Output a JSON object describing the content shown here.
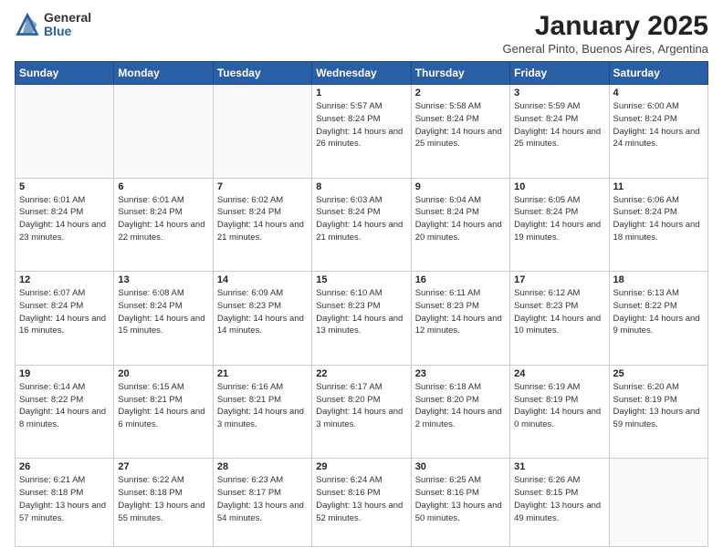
{
  "header": {
    "logo_general": "General",
    "logo_blue": "Blue",
    "month_title": "January 2025",
    "location": "General Pinto, Buenos Aires, Argentina"
  },
  "weekdays": [
    "Sunday",
    "Monday",
    "Tuesday",
    "Wednesday",
    "Thursday",
    "Friday",
    "Saturday"
  ],
  "weeks": [
    [
      {
        "day": "",
        "info": ""
      },
      {
        "day": "",
        "info": ""
      },
      {
        "day": "",
        "info": ""
      },
      {
        "day": "1",
        "info": "Sunrise: 5:57 AM\nSunset: 8:24 PM\nDaylight: 14 hours and 26 minutes."
      },
      {
        "day": "2",
        "info": "Sunrise: 5:58 AM\nSunset: 8:24 PM\nDaylight: 14 hours and 25 minutes."
      },
      {
        "day": "3",
        "info": "Sunrise: 5:59 AM\nSunset: 8:24 PM\nDaylight: 14 hours and 25 minutes."
      },
      {
        "day": "4",
        "info": "Sunrise: 6:00 AM\nSunset: 8:24 PM\nDaylight: 14 hours and 24 minutes."
      }
    ],
    [
      {
        "day": "5",
        "info": "Sunrise: 6:01 AM\nSunset: 8:24 PM\nDaylight: 14 hours and 23 minutes."
      },
      {
        "day": "6",
        "info": "Sunrise: 6:01 AM\nSunset: 8:24 PM\nDaylight: 14 hours and 22 minutes."
      },
      {
        "day": "7",
        "info": "Sunrise: 6:02 AM\nSunset: 8:24 PM\nDaylight: 14 hours and 21 minutes."
      },
      {
        "day": "8",
        "info": "Sunrise: 6:03 AM\nSunset: 8:24 PM\nDaylight: 14 hours and 21 minutes."
      },
      {
        "day": "9",
        "info": "Sunrise: 6:04 AM\nSunset: 8:24 PM\nDaylight: 14 hours and 20 minutes."
      },
      {
        "day": "10",
        "info": "Sunrise: 6:05 AM\nSunset: 8:24 PM\nDaylight: 14 hours and 19 minutes."
      },
      {
        "day": "11",
        "info": "Sunrise: 6:06 AM\nSunset: 8:24 PM\nDaylight: 14 hours and 18 minutes."
      }
    ],
    [
      {
        "day": "12",
        "info": "Sunrise: 6:07 AM\nSunset: 8:24 PM\nDaylight: 14 hours and 16 minutes."
      },
      {
        "day": "13",
        "info": "Sunrise: 6:08 AM\nSunset: 8:24 PM\nDaylight: 14 hours and 15 minutes."
      },
      {
        "day": "14",
        "info": "Sunrise: 6:09 AM\nSunset: 8:23 PM\nDaylight: 14 hours and 14 minutes."
      },
      {
        "day": "15",
        "info": "Sunrise: 6:10 AM\nSunset: 8:23 PM\nDaylight: 14 hours and 13 minutes."
      },
      {
        "day": "16",
        "info": "Sunrise: 6:11 AM\nSunset: 8:23 PM\nDaylight: 14 hours and 12 minutes."
      },
      {
        "day": "17",
        "info": "Sunrise: 6:12 AM\nSunset: 8:23 PM\nDaylight: 14 hours and 10 minutes."
      },
      {
        "day": "18",
        "info": "Sunrise: 6:13 AM\nSunset: 8:22 PM\nDaylight: 14 hours and 9 minutes."
      }
    ],
    [
      {
        "day": "19",
        "info": "Sunrise: 6:14 AM\nSunset: 8:22 PM\nDaylight: 14 hours and 8 minutes."
      },
      {
        "day": "20",
        "info": "Sunrise: 6:15 AM\nSunset: 8:21 PM\nDaylight: 14 hours and 6 minutes."
      },
      {
        "day": "21",
        "info": "Sunrise: 6:16 AM\nSunset: 8:21 PM\nDaylight: 14 hours and 3 minutes."
      },
      {
        "day": "22",
        "info": "Sunrise: 6:17 AM\nSunset: 8:20 PM\nDaylight: 14 hours and 3 minutes."
      },
      {
        "day": "23",
        "info": "Sunrise: 6:18 AM\nSunset: 8:20 PM\nDaylight: 14 hours and 2 minutes."
      },
      {
        "day": "24",
        "info": "Sunrise: 6:19 AM\nSunset: 8:19 PM\nDaylight: 14 hours and 0 minutes."
      },
      {
        "day": "25",
        "info": "Sunrise: 6:20 AM\nSunset: 8:19 PM\nDaylight: 13 hours and 59 minutes."
      }
    ],
    [
      {
        "day": "26",
        "info": "Sunrise: 6:21 AM\nSunset: 8:18 PM\nDaylight: 13 hours and 57 minutes."
      },
      {
        "day": "27",
        "info": "Sunrise: 6:22 AM\nSunset: 8:18 PM\nDaylight: 13 hours and 55 minutes."
      },
      {
        "day": "28",
        "info": "Sunrise: 6:23 AM\nSunset: 8:17 PM\nDaylight: 13 hours and 54 minutes."
      },
      {
        "day": "29",
        "info": "Sunrise: 6:24 AM\nSunset: 8:16 PM\nDaylight: 13 hours and 52 minutes."
      },
      {
        "day": "30",
        "info": "Sunrise: 6:25 AM\nSunset: 8:16 PM\nDaylight: 13 hours and 50 minutes."
      },
      {
        "day": "31",
        "info": "Sunrise: 6:26 AM\nSunset: 8:15 PM\nDaylight: 13 hours and 49 minutes."
      },
      {
        "day": "",
        "info": ""
      }
    ]
  ]
}
